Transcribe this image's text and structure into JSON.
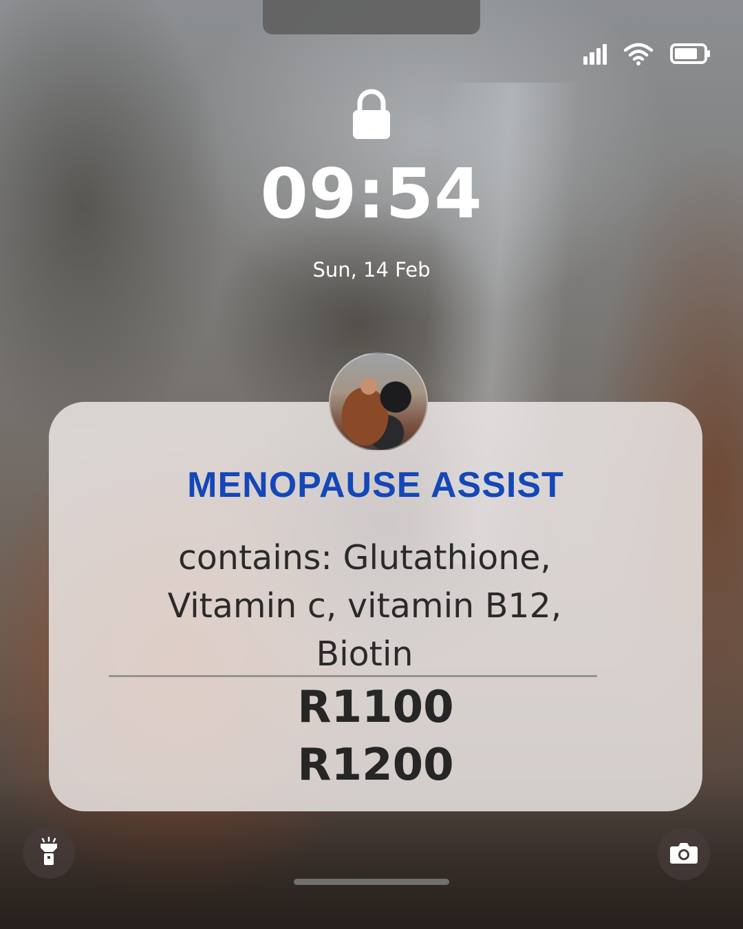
{
  "status_bar": {
    "signal_icon": "signal-bars-icon",
    "wifi_icon": "wifi-icon",
    "battery_icon": "battery-icon",
    "battery_level": 0.8
  },
  "lock_screen": {
    "lock_icon": "lock-icon",
    "time": "09:54",
    "date": "Sun, 14 Feb"
  },
  "notification": {
    "avatar": "couple-photo-avatar",
    "title": "MENOPAUSE ASSIST",
    "title_color": "#1447b8",
    "body_lines": [
      "contains: Glutathione,",
      "Vitamin c, vitamin B12,",
      "Biotin"
    ],
    "prices": [
      "R1100",
      "R1200"
    ]
  },
  "shortcuts": {
    "left_icon": "flashlight-icon",
    "right_icon": "camera-icon"
  }
}
